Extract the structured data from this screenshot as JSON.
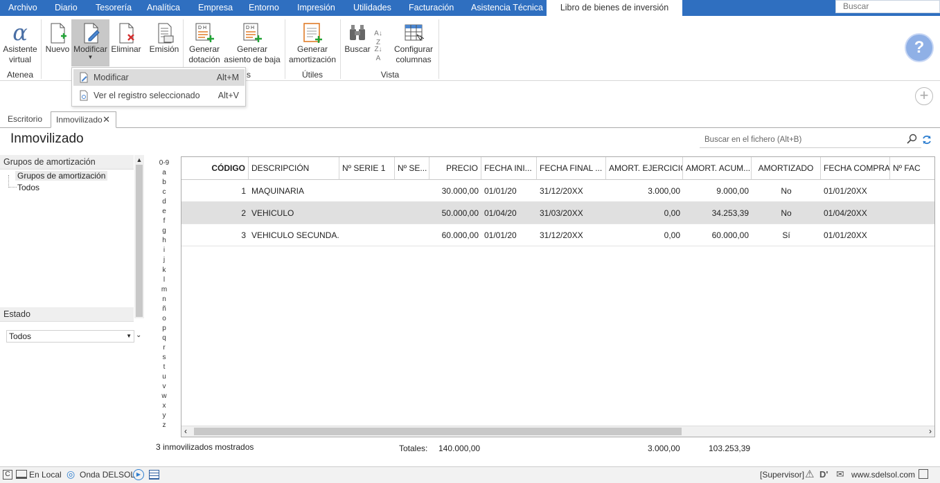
{
  "menu": {
    "items": [
      "Archivo",
      "Diario",
      "Tesorería",
      "Analítica",
      "Empresa",
      "Entorno",
      "Impresión",
      "Utilidades",
      "Facturación",
      "Asistencia Técnica"
    ],
    "active_tab": "Libro de bienes de inversión",
    "search_placeholder": "Buscar"
  },
  "ribbon": {
    "asistente_l1": "Asistente",
    "asistente_l2": "virtual",
    "group_atenea": "Atenea",
    "nuevo": "Nuevo",
    "modificar": "Modificar",
    "eliminar": "Eliminar",
    "emision": "Emisión",
    "gen_dotacion_l1": "Generar",
    "gen_dotacion_l2": "dotación",
    "gen_baja_l1": "Generar",
    "gen_baja_l2": "asiento de baja",
    "group_partial": "s",
    "gen_amort_l1": "Generar",
    "gen_amort_l2": "amortización",
    "group_utiles": "Útiles",
    "buscar": "Buscar",
    "config_l1": "Configurar",
    "config_l2": "columnas",
    "group_vista": "Vista",
    "dh_label": "D H",
    "help_glyph": "?"
  },
  "dropdown": {
    "items": [
      {
        "label": "Modificar",
        "shortcut": "Alt+M"
      },
      {
        "label": "Ver el registro seleccionado",
        "shortcut": "Alt+V"
      }
    ]
  },
  "doc_tabs": {
    "escritorio": "Escritorio",
    "inmovilizado": "Inmovilizado"
  },
  "page": {
    "title": "Inmovilizado",
    "search_placeholder": "Buscar en el fichero (Alt+B)"
  },
  "left_panel": {
    "groups_header": "Grupos de amortización",
    "tree": [
      "Grupos de amortización",
      "Todos"
    ],
    "estado_header": "Estado",
    "estado_value": "Todos"
  },
  "alphabet": [
    "0-9",
    "a",
    "b",
    "c",
    "d",
    "e",
    "f",
    "g",
    "h",
    "i",
    "j",
    "k",
    "l",
    "m",
    "n",
    "ñ",
    "o",
    "p",
    "q",
    "r",
    "s",
    "t",
    "u",
    "v",
    "w",
    "x",
    "y",
    "z"
  ],
  "table": {
    "columns": [
      "CÓDIGO",
      "DESCRIPCIÓN",
      "Nº SERIE 1",
      "Nº SE...",
      "PRECIO",
      "FECHA INI...",
      "FECHA FINAL ...",
      "AMORT. EJERCICIO",
      "AMORT. ACUM...",
      "AMORTIZADO",
      "FECHA COMPRA",
      "Nº FAC"
    ],
    "rows": [
      [
        "1",
        "MAQUINARIA",
        "",
        "",
        "30.000,00",
        "01/01/20",
        "31/12/20XX",
        "3.000,00",
        "9.000,00",
        "No",
        "01/01/20XX",
        ""
      ],
      [
        "2",
        "VEHICULO",
        "",
        "",
        "50.000,00",
        "01/04/20",
        "31/03/20XX",
        "0,00",
        "34.253,39",
        "No",
        "01/04/20XX",
        ""
      ],
      [
        "3",
        "VEHICULO SECUNDA...",
        "",
        "",
        "60.000,00",
        "01/01/20",
        "31/12/20XX",
        "0,00",
        "60.000,00",
        "Sí",
        "01/01/20XX",
        ""
      ]
    ],
    "selected_row": 1
  },
  "footer": {
    "count": "3 inmovilizados mostrados",
    "totales_label": "Totales:",
    "total_precio": "140.000,00",
    "total_ejercicio": "3.000,00",
    "total_acum": "103.253,39"
  },
  "status": {
    "local": "En Local",
    "onda": "Onda DELSOL",
    "supervisor": "[Supervisor]",
    "website": "www.sdelsol.com"
  },
  "colors": {
    "menubar": "#2f6fc0",
    "selected_row": "#e0e0e0",
    "accent_icon": "#e07b28",
    "green_plus": "#21a336"
  }
}
